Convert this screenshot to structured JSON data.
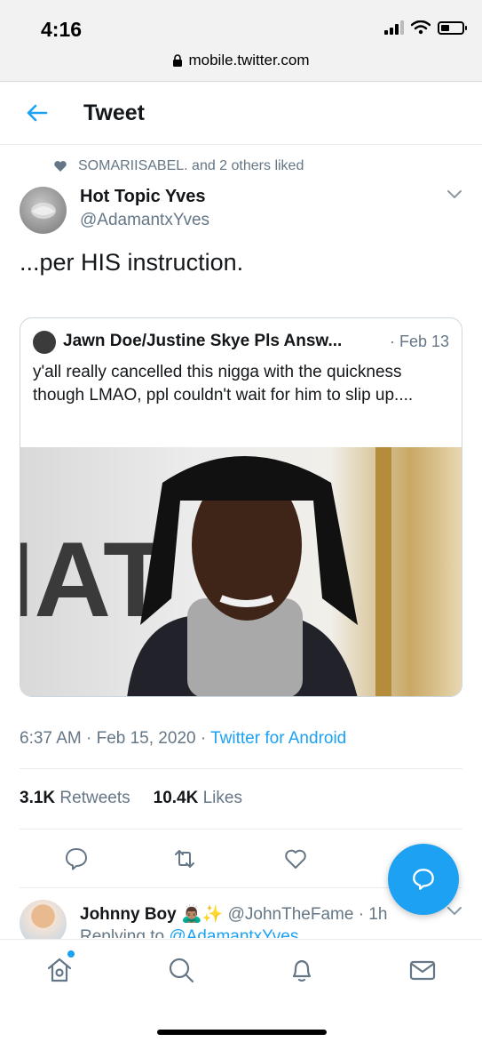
{
  "status_bar": {
    "time": "4:16",
    "battery_level": 0.4
  },
  "browser": {
    "url": "mobile.twitter.com"
  },
  "header": {
    "title": "Tweet"
  },
  "social_context": {
    "text": "SOMARIISABEL. and 2 others liked"
  },
  "tweet": {
    "author_name": "Hot Topic Yves",
    "author_handle": "@AdamantxYves",
    "text": "...per HIS instruction.",
    "timestamp": "6:37 AM · Feb 15, 2020 · ",
    "source": "Twitter for Android",
    "retweets_count": "3.1K",
    "retweets_label": "Retweets",
    "likes_count": "10.4K",
    "likes_label": "Likes"
  },
  "quoted_tweet": {
    "author_name": "Jawn Doe/Justine Skye Pls Answ...",
    "date": "· Feb 13",
    "text": "y'all really cancelled this nigga with the quickness though LMAO, ppl couldn't wait for him to slip up....",
    "photo_sign_text": "IAT"
  },
  "reply_preview": {
    "author_name": "Johnny Boy",
    "emoji": "🙇🏽‍♂️✨",
    "author_handle": "@JohnTheFame",
    "time": "· 1h",
    "replying_prefix": "Replying to ",
    "replying_to": "@AdamantxYves"
  },
  "colors": {
    "accent": "#1da1f2",
    "muted": "#657786",
    "text": "#14171a"
  },
  "icons": [
    "back-arrow-icon",
    "heart-icon",
    "chevron-down-icon",
    "reply-icon",
    "retweet-icon",
    "like-icon",
    "compose-icon",
    "home-icon",
    "search-icon",
    "bell-icon",
    "mail-icon",
    "lock-icon"
  ]
}
